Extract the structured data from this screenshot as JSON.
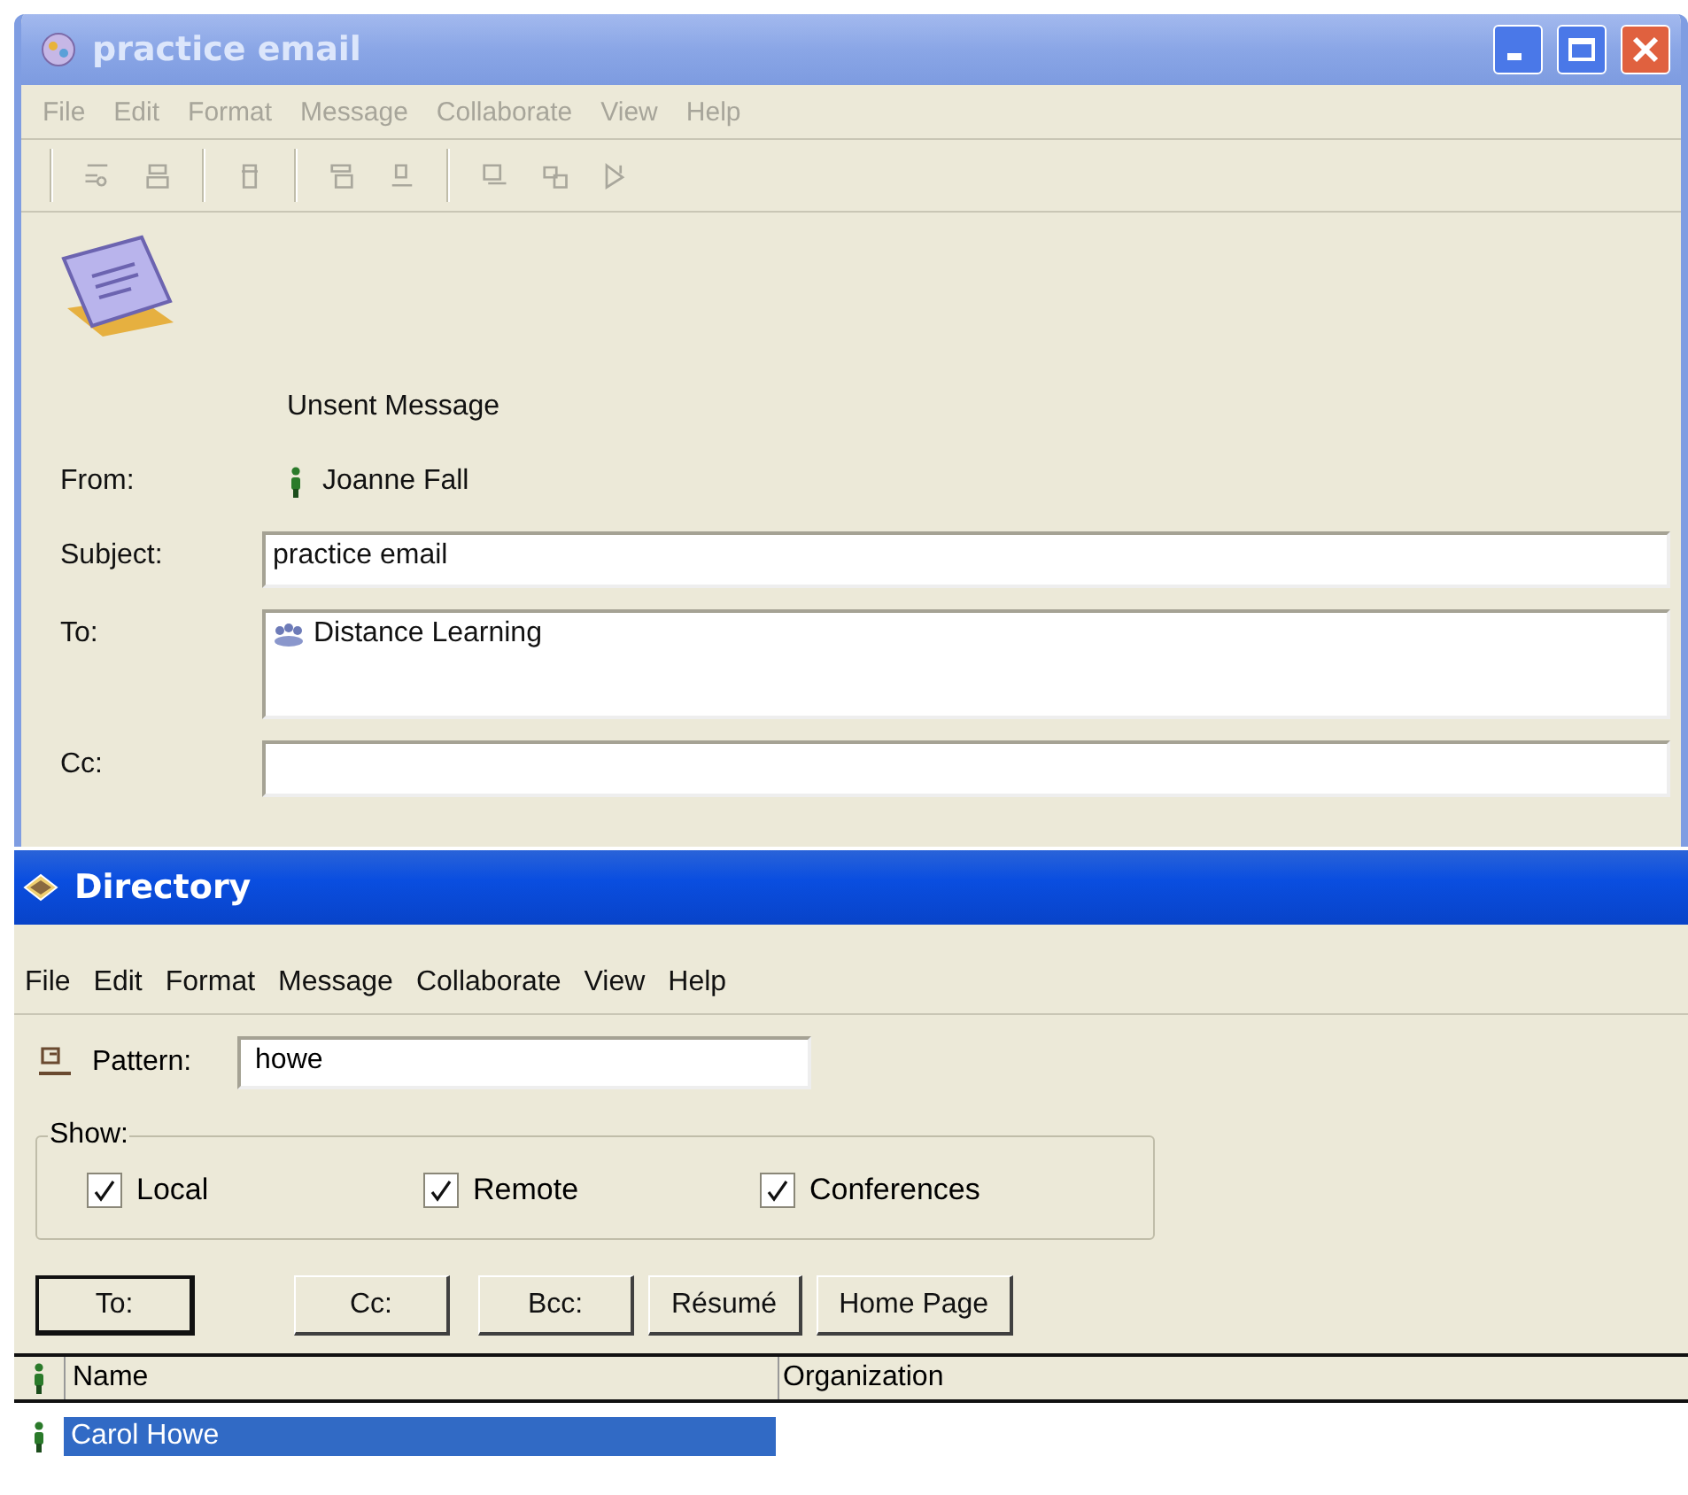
{
  "email_window": {
    "title": "practice email",
    "active": false,
    "menu": [
      "File",
      "Edit",
      "Format",
      "Message",
      "Collaborate",
      "View",
      "Help"
    ],
    "status": "Unsent Message",
    "from": {
      "label": "From:",
      "value": "Joanne Fall"
    },
    "subject": {
      "label": "Subject:",
      "value": "practice email"
    },
    "to": {
      "label": "To:",
      "value": "Distance Learning"
    },
    "cc": {
      "label": "Cc:"
    }
  },
  "directory_window": {
    "title": "Directory",
    "active": true,
    "menu": [
      "File",
      "Edit",
      "Format",
      "Message",
      "Collaborate",
      "View",
      "Help"
    ],
    "pattern": {
      "label": "Pattern:",
      "value": "howe"
    },
    "show": {
      "legend": "Show:",
      "options": [
        {
          "label": "Local",
          "checked": true
        },
        {
          "label": "Remote",
          "checked": true
        },
        {
          "label": "Conferences",
          "checked": true
        }
      ]
    },
    "buttons": [
      {
        "label": "To:",
        "default": true
      },
      {
        "label": "Cc:",
        "default": false
      },
      {
        "label": "Bcc:",
        "default": false
      },
      {
        "label": "Résumé",
        "default": false
      },
      {
        "label": "Home Page",
        "default": false
      }
    ],
    "table": {
      "columns": [
        "Name",
        "Organization"
      ],
      "rows": [
        {
          "name": "Carol Howe",
          "selected": true
        }
      ]
    }
  }
}
